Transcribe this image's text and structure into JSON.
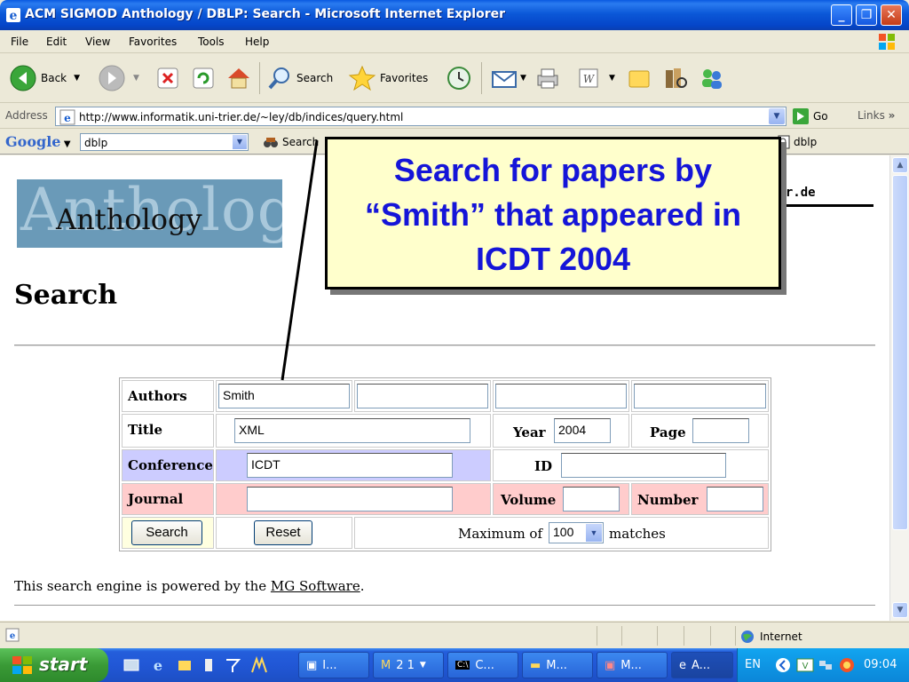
{
  "window": {
    "title": "ACM SIGMOD Anthology / DBLP: Search - Microsoft Internet Explorer"
  },
  "menu": {
    "items": [
      "File",
      "Edit",
      "View",
      "Favorites",
      "Tools",
      "Help"
    ]
  },
  "toolbar": {
    "back": "Back",
    "search": "Search",
    "favorites": "Favorites"
  },
  "address": {
    "label": "Address",
    "url": "http://www.informatik.uni-trier.de/~ley/db/indices/query.html",
    "go": "Go",
    "links": "Links"
  },
  "google": {
    "logo": "Google",
    "query": "dblp",
    "search": "Search",
    "dblp_button": "dblp"
  },
  "page": {
    "logo_big": "Anthology",
    "logo_small": "Anthology",
    "right_fragment": "ier.de",
    "heading": "Search",
    "powered_prefix": "This search engine is powered by the ",
    "powered_link": "MG Software",
    "powered_suffix": "."
  },
  "form": {
    "authors_label": "Authors",
    "author1": "Smith",
    "author2": "",
    "author3": "",
    "author4": "",
    "title_label": "Title",
    "title_value": "XML",
    "year_label": "Year",
    "year_value": "2004",
    "page_label": "Page",
    "page_value": "",
    "conference_label": "Conference",
    "conference_value": "ICDT",
    "id_label": "ID",
    "id_value": "",
    "journal_label": "Journal",
    "journal_value": "",
    "volume_label": "Volume",
    "volume_value": "",
    "number_label": "Number",
    "number_value": "",
    "search_button": "Search",
    "reset_button": "Reset",
    "max_prefix": "Maximum of",
    "max_value": "100",
    "max_suffix": "matches"
  },
  "callout": {
    "line1": "Search for papers by",
    "line2": "“Smith” that appeared in",
    "line3": "ICDT 2004"
  },
  "status": {
    "zone": "Internet"
  },
  "taskbar": {
    "start": "start",
    "items": [
      "I...",
      "2 1",
      "C...",
      "M...",
      "M...",
      "A..."
    ],
    "lang": "EN",
    "clock": "09:04"
  },
  "colors": {
    "conference_bg": "#ccccff",
    "journal_bg": "#ffcccc",
    "callout_text": "#1515d8",
    "callout_bg": "#ffffcc"
  }
}
